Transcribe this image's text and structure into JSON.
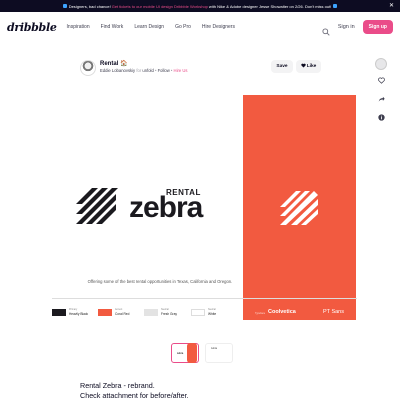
{
  "banner": {
    "text_before": "Designers, bad chance!",
    "link_text": "Get tickets to our mobile UI design Dribbble Workshop",
    "text_after": "with Nike & Adobe designer Jesse Showalter on 2/26. Don't miss out!"
  },
  "nav": {
    "logo": "dribbble",
    "links": [
      "Inspiration",
      "Find Work",
      "Learn Design",
      "Go Pro",
      "Hire Designers"
    ],
    "signin": "Sign in",
    "signup": "Sign up"
  },
  "shot": {
    "title": "Rental 🏠",
    "author": "Eddie Lobanovskiy",
    "for_word": "for",
    "team": "unfold",
    "follow": "Follow",
    "hire": "Hire Us",
    "save_label": "Save",
    "like_label": "Like"
  },
  "artwork": {
    "wordmark_top": "RENTAL",
    "wordmark_main": "zebra",
    "tagline": "Offering some of the best rental opportunities in Texas, California and Oregon.",
    "palette": [
      {
        "label": "Primary",
        "name": "Heavily Black",
        "color": "#1b1a1f"
      },
      {
        "label": "Accent",
        "name": "Coral Red",
        "color": "#f25a40"
      },
      {
        "label": "Neutral",
        "name": "Fresh Gray",
        "color": "#e3e3e3"
      },
      {
        "label": "Neutral",
        "name": "White",
        "color": "#ffffff"
      }
    ],
    "font_label": "Typeface",
    "font_primary": "Coolvetica",
    "font_secondary": "PT Sans"
  },
  "thumbs": {
    "thumb1_label": "zebra",
    "thumb3_label": "zebra"
  },
  "description": {
    "line1": "Rental Zebra - rebrand.",
    "line2": "Check attachment for before/after."
  },
  "colors": {
    "brand_pink": "#ea4c89",
    "coral": "#f25a40",
    "ink": "#0d0c22"
  },
  "icons": [
    "search-icon",
    "heart-icon",
    "comment-icon",
    "share-icon",
    "info-icon",
    "close-icon",
    "home-icon"
  ]
}
